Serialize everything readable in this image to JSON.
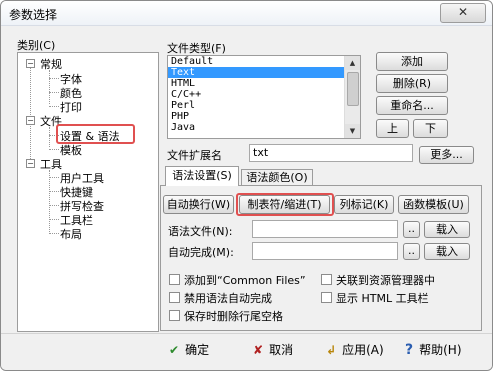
{
  "window": {
    "title": "参数选择",
    "close_glyph": "✕"
  },
  "category": {
    "label": "类别(C)",
    "tree": {
      "general": "常规",
      "font": "字体",
      "color": "颜色",
      "print": "打印",
      "file": "文件",
      "settings_syntax": "设置 & 语法",
      "template": "模板",
      "tools": "工具",
      "user_tools": "用户工具",
      "shortcut": "快捷键",
      "spellcheck": "拼写检查",
      "toolbar": "工具栏",
      "layout": "布局"
    }
  },
  "filetype": {
    "label": "文件类型(F)",
    "items": [
      "Default",
      "Text",
      "HTML",
      "C/C++",
      "Perl",
      "PHP",
      "Java"
    ],
    "selected": "Text",
    "add": "添加",
    "delete": "删除(R)",
    "rename": "重命名...",
    "up": "上",
    "down": "下"
  },
  "extension": {
    "label": "文件扩展名",
    "value": "txt",
    "more": "更多..."
  },
  "tabs": {
    "syntax_settings": "语法设置(S)",
    "syntax_color": "语法颜色(O)"
  },
  "syntax": {
    "auto_wrap": "自动换行(W)",
    "tab_indent": "制表符/缩进(T)",
    "column_marker": "列标记(K)",
    "function_template": "函数模板(U)",
    "syntax_file_label": "语法文件(N):",
    "syntax_file_value": "",
    "browse1": "..",
    "load1": "载入",
    "autocomplete_label": "自动完成(M):",
    "autocomplete_value": "",
    "browse2": "..",
    "load2": "载入"
  },
  "options": {
    "add_common": "添加到“Common Files”",
    "assoc_explorer": "关联到资源管理器中",
    "disable_autocomplete": "禁用语法自动完成",
    "show_html_toolbar": "显示 HTML 工具栏",
    "strip_trailing": "保存时删除行尾空格"
  },
  "footer": {
    "ok": "确定",
    "cancel": "取消",
    "apply": "应用(A)",
    "help": "帮助(H)",
    "ok_icon": "✔",
    "cancel_icon": "✘",
    "apply_icon": "↲",
    "help_icon": "?"
  },
  "colors": {
    "selection": "#3399ff",
    "highlight": "#e05050",
    "ok_green": "#2e8b2e",
    "cancel_red": "#b02020",
    "help_blue": "#2a5db0"
  }
}
